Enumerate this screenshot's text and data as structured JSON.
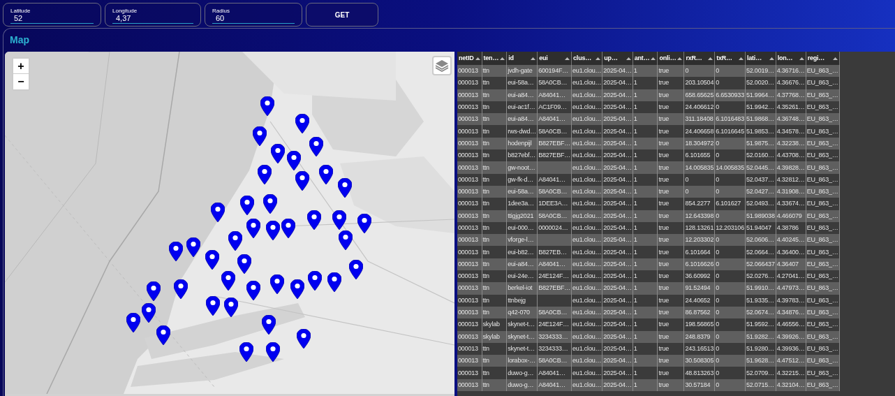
{
  "query": {
    "fields": [
      {
        "label": "Latitude",
        "value": "52"
      },
      {
        "label": "Longitude",
        "value": "4,37"
      },
      {
        "label": "Radius",
        "value": "60"
      }
    ],
    "button": "GET"
  },
  "map_panel": {
    "title": "Map",
    "zoom_in": "+",
    "zoom_out": "−"
  },
  "table": {
    "columns": [
      "netID",
      "ten…",
      "id",
      "eui",
      "clus…",
      "up…",
      "ant…",
      "onli…",
      "rxR…",
      "txR…",
      "lati…",
      "lon…",
      "regi…"
    ],
    "rows": [
      {
        "column_1": "000013",
        "column_2": "ttn",
        "column_3": "jvdh-gate",
        "column_4": "600194F…",
        "column_5": "eu1.clou…",
        "column_6": "2025-04…",
        "column_7": "1",
        "column_8": "true",
        "column_9": "0",
        "column_10": "0",
        "column_11": "52.0019…",
        "column_12": "4.36716…",
        "column_13": "EU_863_…"
      },
      {
        "column_1": "000013",
        "column_2": "ttn",
        "column_3": "eui-58a…",
        "column_4": "58A0CB…",
        "column_5": "eu1.clou…",
        "column_6": "2025-04…",
        "column_7": "1",
        "column_8": "true",
        "column_9": "203.10504",
        "column_10": "0",
        "column_11": "52.0020…",
        "column_12": "4.36676…",
        "column_13": "EU_863_…"
      },
      {
        "column_1": "000013",
        "column_2": "ttn",
        "column_3": "eui-a84…",
        "column_4": "A84041…",
        "column_5": "eu1.clou…",
        "column_6": "2025-04…",
        "column_7": "1",
        "column_8": "true",
        "column_9": "658.65625",
        "column_10": "6.6530933",
        "column_11": "51.9964…",
        "column_12": "4.37768…",
        "column_13": "EU_863_…"
      },
      {
        "column_1": "000013",
        "column_2": "ttn",
        "column_3": "eui-ac1f…",
        "column_4": "AC1F09…",
        "column_5": "eu1.clou…",
        "column_6": "2025-04…",
        "column_7": "1",
        "column_8": "true",
        "column_9": "24.406612",
        "column_10": "0",
        "column_11": "51.9942…",
        "column_12": "4.35261…",
        "column_13": "EU_863_…"
      },
      {
        "column_1": "000013",
        "column_2": "ttn",
        "column_3": "eui-a84…",
        "column_4": "A84041…",
        "column_5": "eu1.clou…",
        "column_6": "2025-04…",
        "column_7": "1",
        "column_8": "true",
        "column_9": "311.18408",
        "column_10": "6.1016483",
        "column_11": "51.9868…",
        "column_12": "4.36748…",
        "column_13": "EU_863_…"
      },
      {
        "column_1": "000013",
        "column_2": "ttn",
        "column_3": "rws-dwd…",
        "column_4": "58A0CB…",
        "column_5": "eu1.clou…",
        "column_6": "2025-04…",
        "column_7": "1",
        "column_8": "true",
        "column_9": "24.406658",
        "column_10": "6.1016645",
        "column_11": "51.9853…",
        "column_12": "4.34578…",
        "column_13": "EU_863_…"
      },
      {
        "column_1": "000013",
        "column_2": "ttn",
        "column_3": "hodenpijl",
        "column_4": "B827EBF…",
        "column_5": "eu1.clou…",
        "column_6": "2025-04…",
        "column_7": "1",
        "column_8": "true",
        "column_9": "18.304972",
        "column_10": "0",
        "column_11": "51.9875…",
        "column_12": "4.32238…",
        "column_13": "EU_863_…"
      },
      {
        "column_1": "000013",
        "column_2": "ttn",
        "column_3": "b827ebf…",
        "column_4": "B827EBF…",
        "column_5": "eu1.clou…",
        "column_6": "2025-04…",
        "column_7": "1",
        "column_8": "true",
        "column_9": "6.101655",
        "column_10": "0",
        "column_11": "52.0160…",
        "column_12": "4.43708…",
        "column_13": "EU_863_…"
      },
      {
        "column_1": "000013",
        "column_2": "ttn",
        "column_3": "gw-noot…",
        "column_5": "eu1.clou…",
        "column_6": "2025-04…",
        "column_7": "1",
        "column_8": "true",
        "column_9": "14.005835",
        "column_10": "14.005835",
        "column_11": "52.0445…",
        "column_12": "4.39828…",
        "column_13": "EU_863_…"
      },
      {
        "column_1": "000013",
        "column_2": "ttn",
        "column_3": "gw-fk-d…",
        "column_4": "A84041…",
        "column_5": "eu1.clou…",
        "column_6": "2025-04…",
        "column_7": "1",
        "column_8": "true",
        "column_9": "0",
        "column_10": "0",
        "column_11": "52.0437…",
        "column_12": "4.32812…",
        "column_13": "EU_863_…"
      },
      {
        "column_1": "000013",
        "column_2": "ttn",
        "column_3": "eui-58a…",
        "column_4": "58A0CB…",
        "column_5": "eu1.clou…",
        "column_6": "2025-04…",
        "column_7": "1",
        "column_8": "true",
        "column_9": "0",
        "column_10": "0",
        "column_11": "52.0427…",
        "column_12": "4.31908…",
        "column_13": "EU_863_…"
      },
      {
        "column_1": "000013",
        "column_2": "ttn",
        "column_3": "1dee3a…",
        "column_4": "1DEE3A…",
        "column_5": "eu1.clou…",
        "column_6": "2025-04…",
        "column_7": "1",
        "column_8": "true",
        "column_9": "854.2277",
        "column_10": "6.101627",
        "column_11": "52.0493…",
        "column_12": "4.33674…",
        "column_13": "EU_863_…"
      },
      {
        "column_1": "000013",
        "column_2": "ttn",
        "column_3": "ttigjg2021",
        "column_4": "58A0CB…",
        "column_5": "eu1.clou…",
        "column_6": "2025-04…",
        "column_7": "1",
        "column_8": "true",
        "column_9": "12.643398",
        "column_10": "0",
        "column_11": "51.989038",
        "column_12": "4.466079",
        "column_13": "EU_863_…"
      },
      {
        "column_1": "000013",
        "column_2": "ttn",
        "column_3": "eui-000…",
        "column_4": "0000024…",
        "column_5": "eu1.clou…",
        "column_6": "2025-04…",
        "column_7": "1",
        "column_8": "true",
        "column_9": "128.13261",
        "column_10": "12.203106",
        "column_11": "51.94047",
        "column_12": "4.38786",
        "column_13": "EU_863_…"
      },
      {
        "column_1": "000013",
        "column_2": "ttn",
        "column_3": "vforge-l…",
        "column_5": "eu1.clou…",
        "column_6": "2025-04…",
        "column_7": "1",
        "column_8": "true",
        "column_9": "12.203302",
        "column_10": "0",
        "column_11": "52.0606…",
        "column_12": "4.40245…",
        "column_13": "EU_863_…"
      },
      {
        "column_1": "000013",
        "column_2": "ttn",
        "column_3": "eui-b82…",
        "column_4": "B827EB…",
        "column_5": "eu1.clou…",
        "column_6": "2025-04…",
        "column_7": "1",
        "column_8": "true",
        "column_9": "6.101664",
        "column_10": "0",
        "column_11": "52.0664…",
        "column_12": "4.36400…",
        "column_13": "EU_863_…"
      },
      {
        "column_1": "000013",
        "column_2": "ttn",
        "column_3": "eui-a84…",
        "column_4": "A84041…",
        "column_5": "eu1.clou…",
        "column_6": "2025-04…",
        "column_7": "1",
        "column_8": "true",
        "column_9": "6.1016626",
        "column_10": "0",
        "column_11": "52.066437",
        "column_12": "4.36407",
        "column_13": "EU_863_…"
      },
      {
        "column_1": "000013",
        "column_2": "ttn",
        "column_3": "eui-24e…",
        "column_4": "24E124F…",
        "column_5": "eu1.clou…",
        "column_6": "2025-04…",
        "column_7": "1",
        "column_8": "true",
        "column_9": "36.60992",
        "column_10": "0",
        "column_11": "52.0276…",
        "column_12": "4.27041…",
        "column_13": "EU_863_…"
      },
      {
        "column_1": "000013",
        "column_2": "ttn",
        "column_3": "berkel-iot",
        "column_4": "B827EBF…",
        "column_5": "eu1.clou…",
        "column_6": "2025-04…",
        "column_7": "1",
        "column_8": "true",
        "column_9": "91.52494",
        "column_10": "0",
        "column_11": "51.9910…",
        "column_12": "4.47973…",
        "column_13": "EU_863_…"
      },
      {
        "column_1": "000013",
        "column_2": "ttn",
        "column_3": "ttnbejg",
        "column_5": "eu1.clou…",
        "column_6": "2025-04…",
        "column_7": "1",
        "column_8": "true",
        "column_9": "24.40652",
        "column_10": "0",
        "column_11": "51.9335…",
        "column_12": "4.39783…",
        "column_13": "EU_863_…"
      },
      {
        "column_1": "000013",
        "column_2": "ttn",
        "column_3": "q42-070",
        "column_4": "58A0CB…",
        "column_5": "eu1.clou…",
        "column_6": "2025-04…",
        "column_7": "1",
        "column_8": "true",
        "column_9": "86.87562",
        "column_10": "0",
        "column_11": "52.0674…",
        "column_12": "4.34876…",
        "column_13": "EU_863_…"
      },
      {
        "column_1": "000013",
        "column_2": "skylab",
        "column_3": "skynet-t…",
        "column_4": "24E124F…",
        "column_5": "eu1.clou…",
        "column_6": "2025-04…",
        "column_7": "1",
        "column_8": "true",
        "column_9": "198.56865",
        "column_10": "0",
        "column_11": "51.9592…",
        "column_12": "4.46556…",
        "column_13": "EU_863_…"
      },
      {
        "column_1": "000013",
        "column_2": "skylab",
        "column_3": "skynet-t…",
        "column_4": "3234333…",
        "column_5": "eu1.clou…",
        "column_6": "2025-04…",
        "column_7": "1",
        "column_8": "true",
        "column_9": "248.8379",
        "column_10": "0",
        "column_11": "51.9282…",
        "column_12": "4.39926…",
        "column_13": "EU_863_…"
      },
      {
        "column_1": "000013",
        "column_2": "ttn",
        "column_3": "skynet-t…",
        "column_4": "3234333…",
        "column_5": "eu1.clou…",
        "column_6": "2025-04…",
        "column_7": "1",
        "column_8": "true",
        "column_9": "243.16513",
        "column_10": "0",
        "column_11": "51.9280…",
        "column_12": "4.39936…",
        "column_13": "EU_863_…"
      },
      {
        "column_1": "000013",
        "column_2": "ttn",
        "column_3": "lorabox-…",
        "column_4": "58A0CB…",
        "column_5": "eu1.clou…",
        "column_6": "2025-04…",
        "column_7": "1",
        "column_8": "true",
        "column_9": "30.508305",
        "column_10": "0",
        "column_11": "51.9628…",
        "column_12": "4.47512…",
        "column_13": "EU_863_…"
      },
      {
        "column_1": "000013",
        "column_2": "ttn",
        "column_3": "duwo-g…",
        "column_4": "A84041…",
        "column_5": "eu1.clou…",
        "column_6": "2025-04…",
        "column_7": "1",
        "column_8": "true",
        "column_9": "48.813263",
        "column_10": "0",
        "column_11": "52.0709…",
        "column_12": "4.32215…",
        "column_13": "EU_863_…"
      },
      {
        "column_1": "000013",
        "column_2": "ttn",
        "column_3": "duwo-g…",
        "column_4": "A84041…",
        "column_5": "eu1.clou…",
        "column_6": "2025-04…",
        "column_7": "1",
        "column_8": "true",
        "column_9": "30.57184",
        "column_10": "0",
        "column_11": "52.0715…",
        "column_12": "4.32104…",
        "column_13": "EU_863_…"
      }
    ]
  }
}
